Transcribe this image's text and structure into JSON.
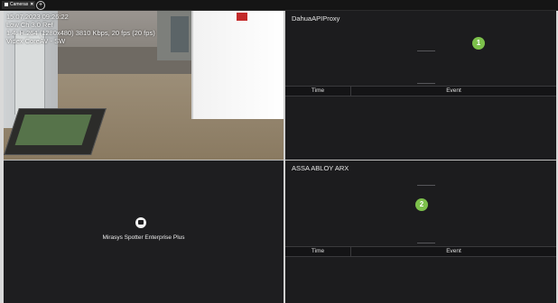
{
  "tabs": [
    {
      "label": "Cameras",
      "close": "✕"
    }
  ],
  "tab_add_label": "+",
  "video": {
    "overlay_lines": [
      "15.07.2023 09:26:22",
      "Low Ch 3.0 Ref",
      "1.4: H.264 (1280x480) 3810 Kbps, 20 fps (20 fps)",
      "Videx CoreAV - SW"
    ]
  },
  "event_panels": [
    {
      "title": "DahuaAPIProxy",
      "badge": "1",
      "col_time": "Time",
      "col_event": "Event"
    },
    {
      "title": "ASSA ABLOY ARX",
      "badge": "2",
      "col_time": "Time",
      "col_event": "Event"
    }
  ],
  "spotter": {
    "label": "Mirasys Spotter Enterprise Plus",
    "icon": "camera-icon"
  },
  "colors": {
    "badge": "#7cc04b",
    "pane_bg": "#1c1c1e",
    "topbar": "#151515"
  }
}
